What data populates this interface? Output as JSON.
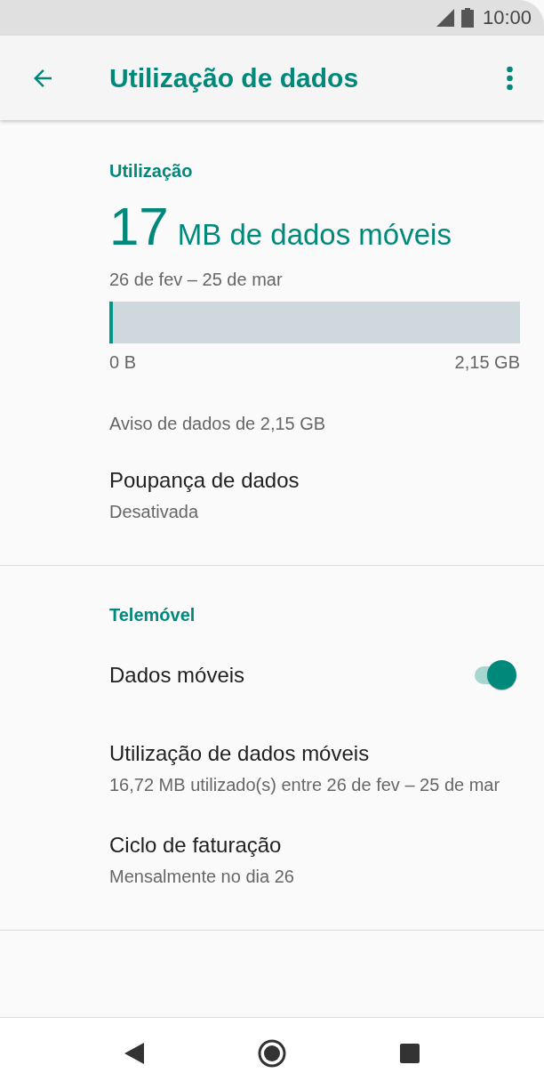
{
  "status_bar": {
    "time": "10:00"
  },
  "app_bar": {
    "title": "Utilização de dados"
  },
  "usage": {
    "header": "Utilização",
    "amount": "17",
    "unit": "MB de dados móveis",
    "period": "26 de fev – 25 de mar",
    "level": 0.008,
    "min_label": "0 B",
    "max_label": "2,15 GB",
    "warning": "Aviso de dados de 2,15 GB"
  },
  "sections": [
    {
      "items": [
        {
          "kind": "text",
          "title": "Poupança de dados",
          "summary": "Desativada"
        }
      ]
    },
    {
      "header": "Telemóvel",
      "items": [
        {
          "kind": "toggle",
          "title": "Dados móveis",
          "on": true
        },
        {
          "kind": "text",
          "title": "Utilização de dados móveis",
          "summary": "16,72 MB utilizado(s) entre 26 de fev – 25 de mar"
        },
        {
          "kind": "text",
          "title": "Ciclo de faturação",
          "summary": "Mensalmente no dia 26"
        }
      ]
    }
  ]
}
